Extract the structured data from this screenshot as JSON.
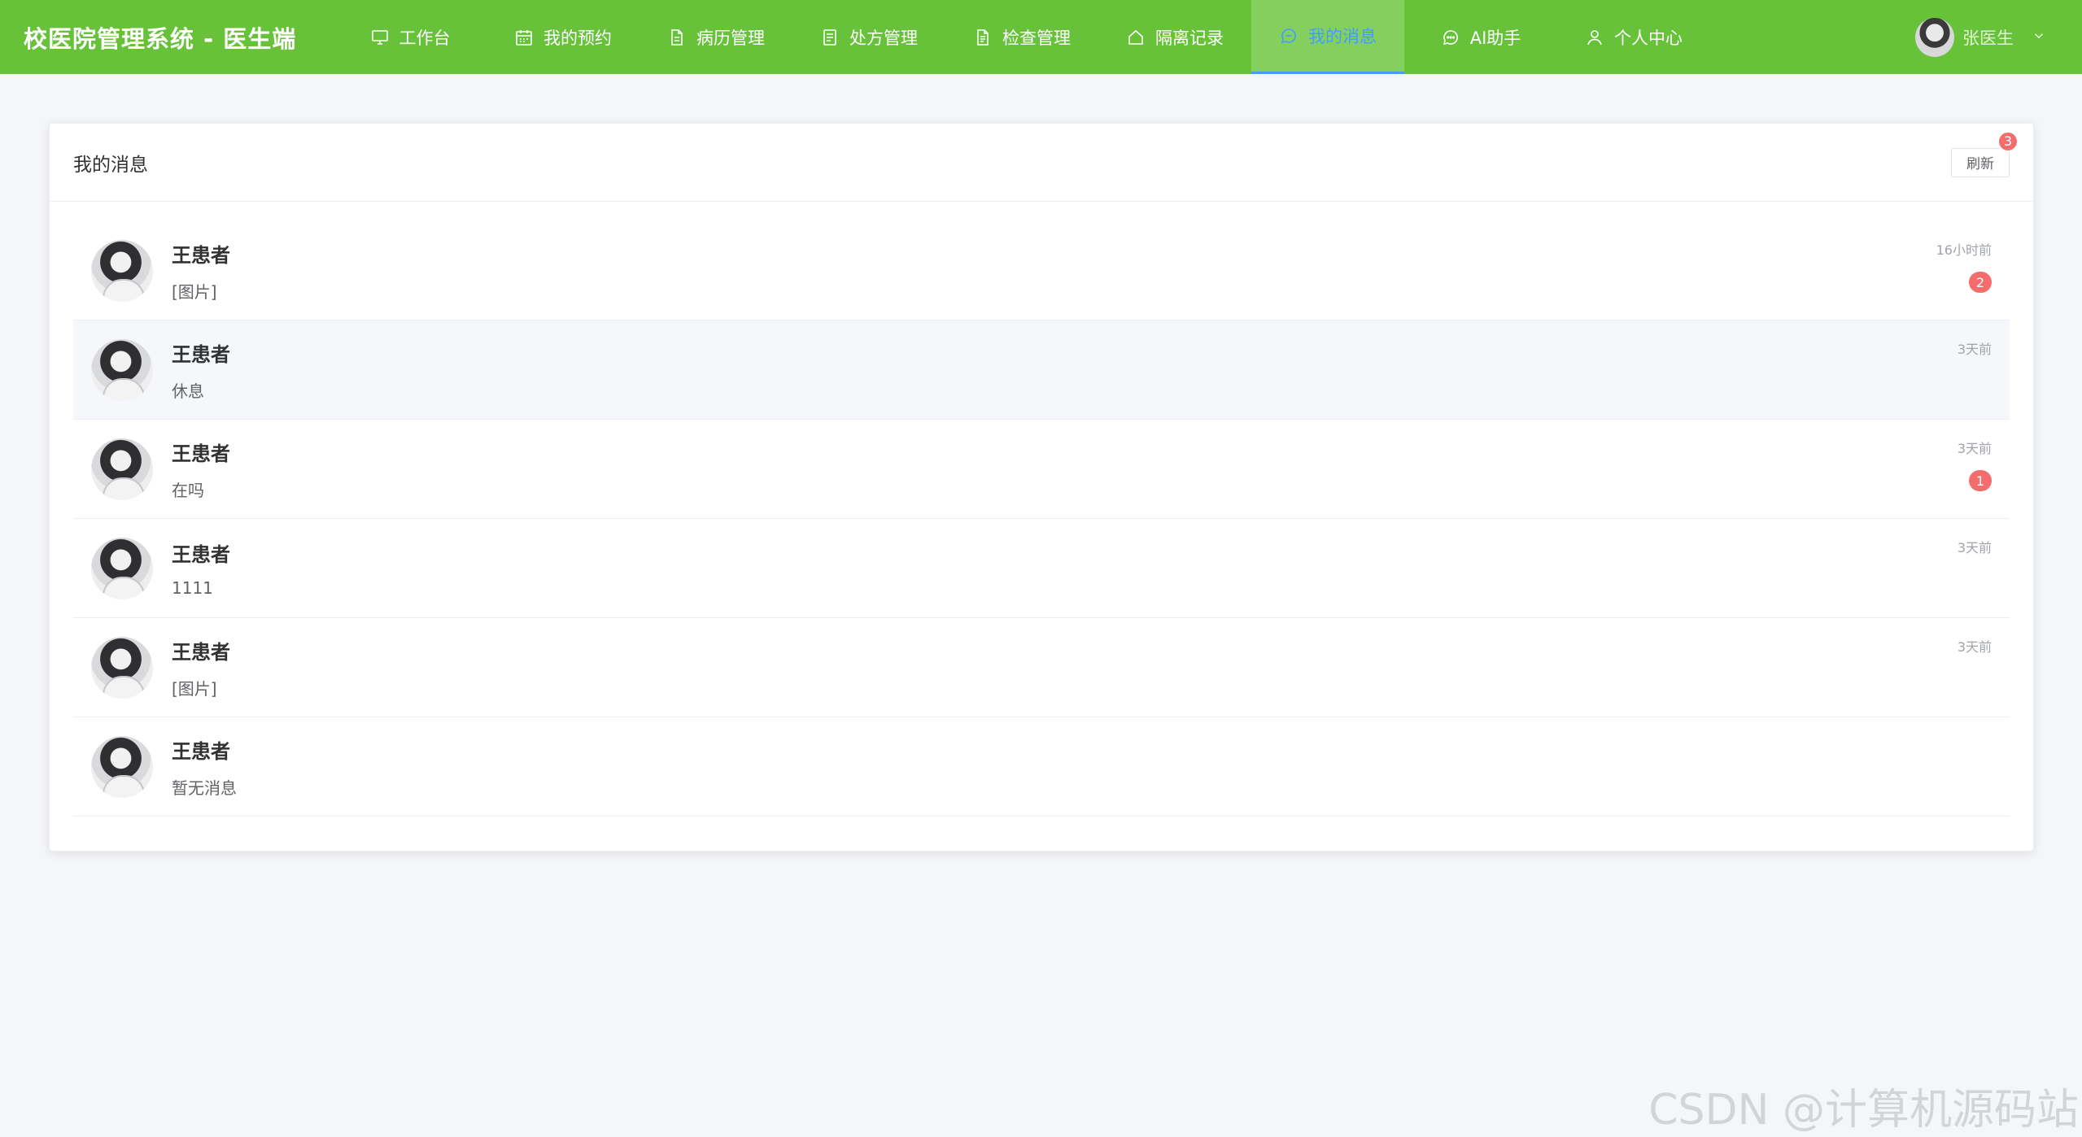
{
  "header": {
    "brand": "校医院管理系统 - 医生端",
    "nav": [
      {
        "label": "工作台",
        "icon": "monitor-icon"
      },
      {
        "label": "我的预约",
        "icon": "calendar-icon"
      },
      {
        "label": "病历管理",
        "icon": "document-icon"
      },
      {
        "label": "处方管理",
        "icon": "list-document-icon"
      },
      {
        "label": "检查管理",
        "icon": "report-icon"
      },
      {
        "label": "隔离记录",
        "icon": "house-icon"
      },
      {
        "label": "我的消息",
        "icon": "chat-bubble-icon",
        "active": true
      },
      {
        "label": "AI助手",
        "icon": "chat-dots-icon"
      },
      {
        "label": "个人中心",
        "icon": "user-icon"
      }
    ],
    "user_name": "张医生"
  },
  "card": {
    "title": "我的消息",
    "refresh_label": "刷新",
    "refresh_badge": "3"
  },
  "messages": [
    {
      "name": "王患者",
      "text": "[图片]",
      "time": "16小时前",
      "unread": "2"
    },
    {
      "name": "王患者",
      "text": "休息",
      "time": "3天前",
      "unread": ""
    },
    {
      "name": "王患者",
      "text": "在吗",
      "time": "3天前",
      "unread": "1"
    },
    {
      "name": "王患者",
      "text": "1111",
      "time": "3天前",
      "unread": ""
    },
    {
      "name": "王患者",
      "text": "[图片]",
      "time": "3天前",
      "unread": ""
    },
    {
      "name": "王患者",
      "text": "暂无消息",
      "time": "",
      "unread": ""
    }
  ],
  "watermark": "CSDN @计算机源码站",
  "colors": {
    "header_bg": "#67c23a",
    "active_tab_text": "#409eff",
    "badge": "#f56c6c"
  }
}
